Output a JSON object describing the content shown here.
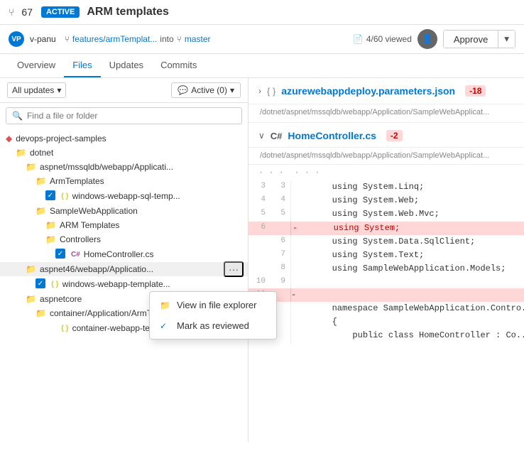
{
  "topbar": {
    "pr_icon": "⑂",
    "pr_number": "67",
    "active_badge": "ACTIVE",
    "pr_title": "ARM templates"
  },
  "userrow": {
    "avatar_initials": "VP",
    "user_name": "v-panu",
    "branch_icon": "⑂",
    "branch_from": "features/armTemplat...",
    "into_text": "into",
    "branch_into_icon": "⑂",
    "branch_to": "master",
    "viewed_count": "4/60 viewed",
    "approve_label": "Approve",
    "chevron": "▾"
  },
  "nav": {
    "tabs": [
      {
        "id": "overview",
        "label": "Overview"
      },
      {
        "id": "files",
        "label": "Files",
        "active": true
      },
      {
        "id": "updates",
        "label": "Updates"
      },
      {
        "id": "commits",
        "label": "Commits"
      }
    ]
  },
  "filter": {
    "all_updates_label": "All updates",
    "active_filter_label": "Active (0)"
  },
  "search": {
    "placeholder": "Find a file or folder"
  },
  "tree": {
    "items": [
      {
        "id": "repo",
        "label": "devops-project-samples",
        "indent": 0,
        "type": "repo"
      },
      {
        "id": "dotnet",
        "label": "dotnet",
        "indent": 1,
        "type": "folder"
      },
      {
        "id": "aspnet1",
        "label": "aspnet/mssqldb/webapp/Applicati...",
        "indent": 2,
        "type": "folder"
      },
      {
        "id": "armtemplates1",
        "label": "ArmTemplates",
        "indent": 3,
        "type": "folder"
      },
      {
        "id": "windows-sql",
        "label": "windows-webapp-sql-temp...",
        "indent": 4,
        "type": "json",
        "checked": true
      },
      {
        "id": "samplewebapp",
        "label": "SampleWebApplication",
        "indent": 3,
        "type": "folder"
      },
      {
        "id": "armtemplates2",
        "label": "ARM Templates",
        "indent": 4,
        "type": "folder"
      },
      {
        "id": "controllers",
        "label": "Controllers",
        "indent": 4,
        "type": "folder"
      },
      {
        "id": "homecontroller",
        "label": "HomeController.cs",
        "indent": 5,
        "type": "cs",
        "checked": true
      },
      {
        "id": "aspnet46",
        "label": "aspnet46/webapp/Applicatio...",
        "indent": 2,
        "type": "folder",
        "showDots": true
      },
      {
        "id": "windows-webapp-templ",
        "label": "windows-webapp-template...",
        "indent": 3,
        "type": "json",
        "checked": true
      },
      {
        "id": "aspnetcore",
        "label": "aspnetcore",
        "indent": 2,
        "type": "folder"
      },
      {
        "id": "container-arm",
        "label": "container/Application/ArmTe...",
        "indent": 3,
        "type": "folder"
      },
      {
        "id": "container-webapp",
        "label": "container-webapp-templat...",
        "indent": 4,
        "type": "json"
      }
    ]
  },
  "context_menu": {
    "items": [
      {
        "id": "view-explorer",
        "icon": "📁",
        "label": "View in file explorer",
        "checked": false
      },
      {
        "id": "mark-reviewed",
        "icon": "",
        "label": "Mark as reviewed",
        "checked": true
      }
    ]
  },
  "right_panel": {
    "file1": {
      "name": "azurewebappdeploy.parameters.json",
      "diff": "-18",
      "path": "/dotnet/aspnet/mssqldb/webapp/Application/SampleWebApplicat...",
      "collapse_icon": "›",
      "brace_icon": "{ }"
    },
    "file2": {
      "name": "HomeController.cs",
      "diff": "-2",
      "path": "/dotnet/aspnet/mssqldb/webapp/Application/SampleWebApplicat...",
      "lang": "C#",
      "collapse_icon": "∨"
    },
    "code_lines": [
      {
        "old": "...",
        "new": "...",
        "content": "",
        "type": "ellipsis"
      },
      {
        "old": "3",
        "new": "3",
        "content": "        using System.Linq;",
        "type": "normal"
      },
      {
        "old": "4",
        "new": "4",
        "content": "        using System.Web;",
        "type": "normal"
      },
      {
        "old": "5",
        "new": "5",
        "content": "        using System.Web.Mvc;",
        "type": "normal"
      },
      {
        "old": "6",
        "new": "",
        "content": "        using System;",
        "type": "removed"
      },
      {
        "old": "",
        "new": "6",
        "content": "        using System.Data.SqlClient;",
        "type": "normal"
      },
      {
        "old": "",
        "new": "7",
        "content": "        using System.Text;",
        "type": "normal"
      },
      {
        "old": "",
        "new": "8",
        "content": "        using SampleWebApplication.Models;",
        "type": "normal"
      },
      {
        "old": "10",
        "new": "9",
        "content": "",
        "type": "normal"
      },
      {
        "old": "11",
        "new": "",
        "content": "",
        "type": "removed-marker"
      },
      {
        "old": "",
        "new": "",
        "content": "        namespace SampleWebApplication.Contro...",
        "type": "normal"
      },
      {
        "old": "",
        "new": "",
        "content": "        {",
        "type": "normal"
      },
      {
        "old": "",
        "new": "",
        "content": "            public class HomeController : Co...",
        "type": "normal"
      }
    ]
  }
}
